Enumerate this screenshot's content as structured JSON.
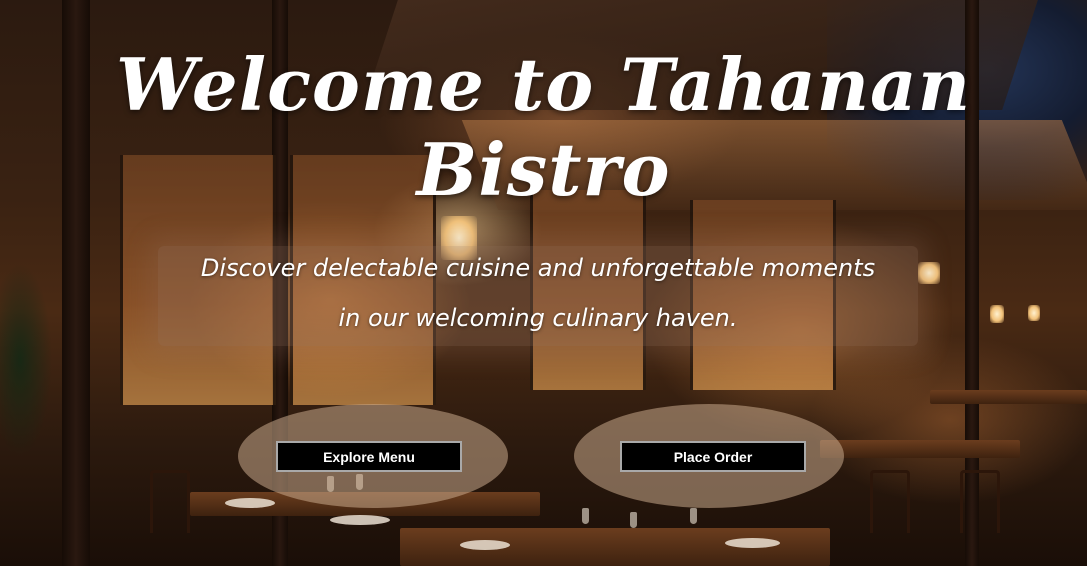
{
  "hero": {
    "title": "Welcome to Tahanan Bistro",
    "tagline_line1": "Discover delectable cuisine and unforgettable moments",
    "tagline_line2": "in our welcoming culinary haven."
  },
  "actions": {
    "explore_label": "Explore Menu",
    "order_label": "Place Order"
  },
  "colors": {
    "button_bg": "#000000",
    "button_text": "#ffffff",
    "button_border": "#a9a9a9",
    "halo": "#c8aa8c",
    "title": "#ffffff"
  }
}
